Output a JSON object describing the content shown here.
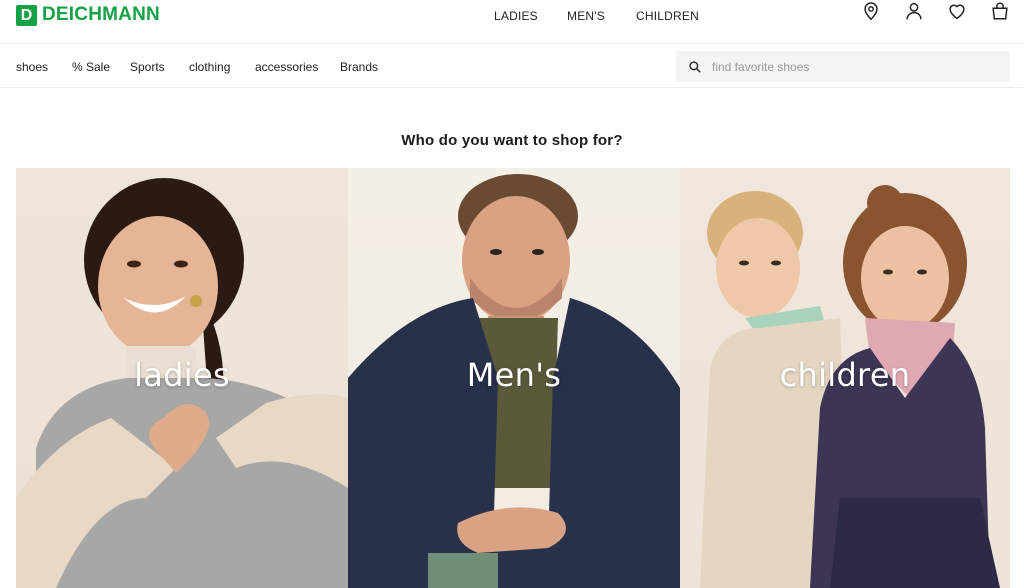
{
  "brand": {
    "logo_letter": "D",
    "name": "DEICHMANN",
    "color": "#15a146"
  },
  "gender_nav": {
    "ladies": "LADIES",
    "mens": "MEN'S",
    "children": "CHILDREN"
  },
  "header_icons": [
    "location-pin-icon",
    "user-icon",
    "heart-icon",
    "shopping-bag-icon"
  ],
  "categories": [
    "shoes",
    "% Sale",
    "Sports",
    "clothing",
    "accessories",
    "Brands"
  ],
  "search": {
    "placeholder": "find favorite shoes",
    "value": ""
  },
  "heading": "Who do you want to shop for?",
  "tiles": [
    {
      "label": "ladies"
    },
    {
      "label": "Men's"
    },
    {
      "label": "children"
    }
  ]
}
